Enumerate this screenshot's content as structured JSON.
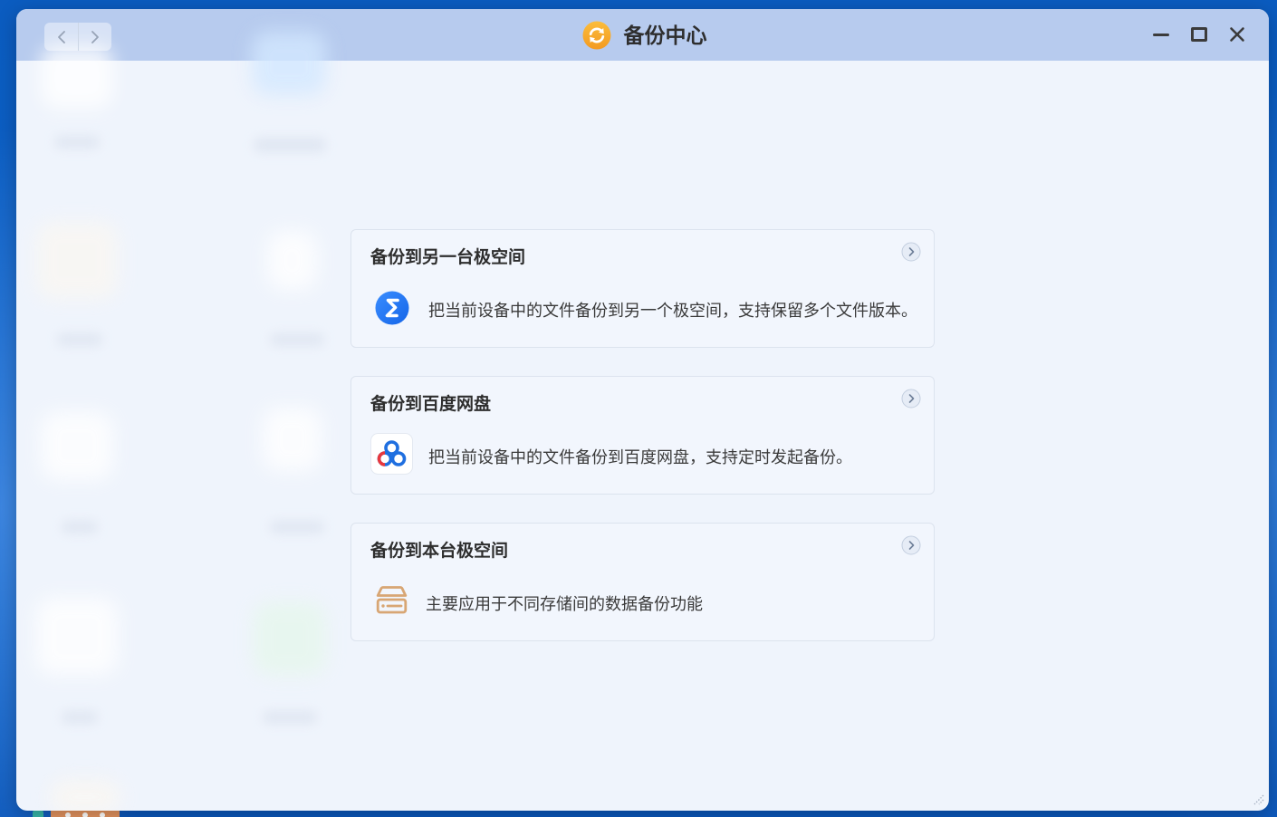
{
  "window": {
    "title": "备份中心",
    "app_icon": "sync-arrows-icon",
    "nav": {
      "back_icon": "chevron-left-icon",
      "forward_icon": "chevron-right-icon"
    },
    "controls": {
      "minimize_icon": "minimize-icon",
      "maximize_icon": "maximize-icon",
      "close_icon": "close-icon"
    }
  },
  "backup_options": [
    {
      "title": "备份到另一台极空间",
      "description": "把当前设备中的文件备份到另一个极空间，支持保留多个文件版本。",
      "icon": "zspace-logo-icon",
      "arrow_icon": "chevron-right-circle-icon"
    },
    {
      "title": "备份到百度网盘",
      "description": "把当前设备中的文件备份到百度网盘，支持定时发起备份。",
      "icon": "baidu-netdisk-icon",
      "arrow_icon": "chevron-right-circle-icon"
    },
    {
      "title": "备份到本台极空间",
      "description": "主要应用于不同存储间的数据备份功能",
      "icon": "local-storage-icon",
      "arrow_icon": "chevron-right-circle-icon"
    }
  ],
  "colors": {
    "desktop_background": "#0b5cc0",
    "titlebar": "#b7cbee",
    "window_body": "#eff4fc",
    "card_border": "#dce3ee",
    "text_primary": "#2e2e2e",
    "app_icon_orange": "#f39a21",
    "zspace_blue": "#1565e8",
    "baidu_blue": "#1f6fe0",
    "baidu_red": "#e8383d",
    "storage_tan": "#d8a674"
  }
}
